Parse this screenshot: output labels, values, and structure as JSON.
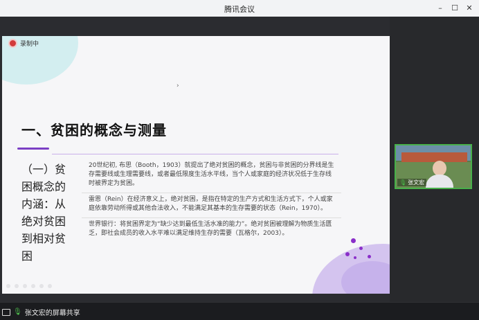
{
  "window": {
    "title": "腾讯会议",
    "minimize": "–",
    "maximize": "☐",
    "close": "✕"
  },
  "recording": {
    "label": "录制中"
  },
  "slide": {
    "nav_hint": "›",
    "heading": "一、贫困的概念与测量",
    "subheading": "（一）贫困概念的内涵：从绝对贫困到相对贫困",
    "points": [
      "20世纪初, 布思（Booth，1903）就提出了绝对贫困的概念，贫困与非贫困的分界线是生存需要线或生理需要线，或者最低限度生活水平线，当个人或家庭的经济状况低于生存线时被界定为贫困。",
      "雷恩（Rein）在经济意义上，绝对贫困，是指在特定的生产方式和生活方式下，个人或家庭依靠劳动所得或其他合法收入，不能满足其基本的生存需要的状态（Rein，1970）。",
      "世界银行：将贫困界定为“缺少达到最低生活水准的能力”。绝对贫困被理解为物质生活匮乏，即社会成员的收入水平难以满足维持生存的需要（瓦格尔，2003）。"
    ]
  },
  "participant": {
    "name": "张文宏",
    "mic_icon": "mic-icon"
  },
  "share": {
    "label": "张文宏的屏幕共享"
  },
  "colors": {
    "accent": "#7b3fc4",
    "recording": "#d23b3b",
    "mic": "#48c04a"
  }
}
